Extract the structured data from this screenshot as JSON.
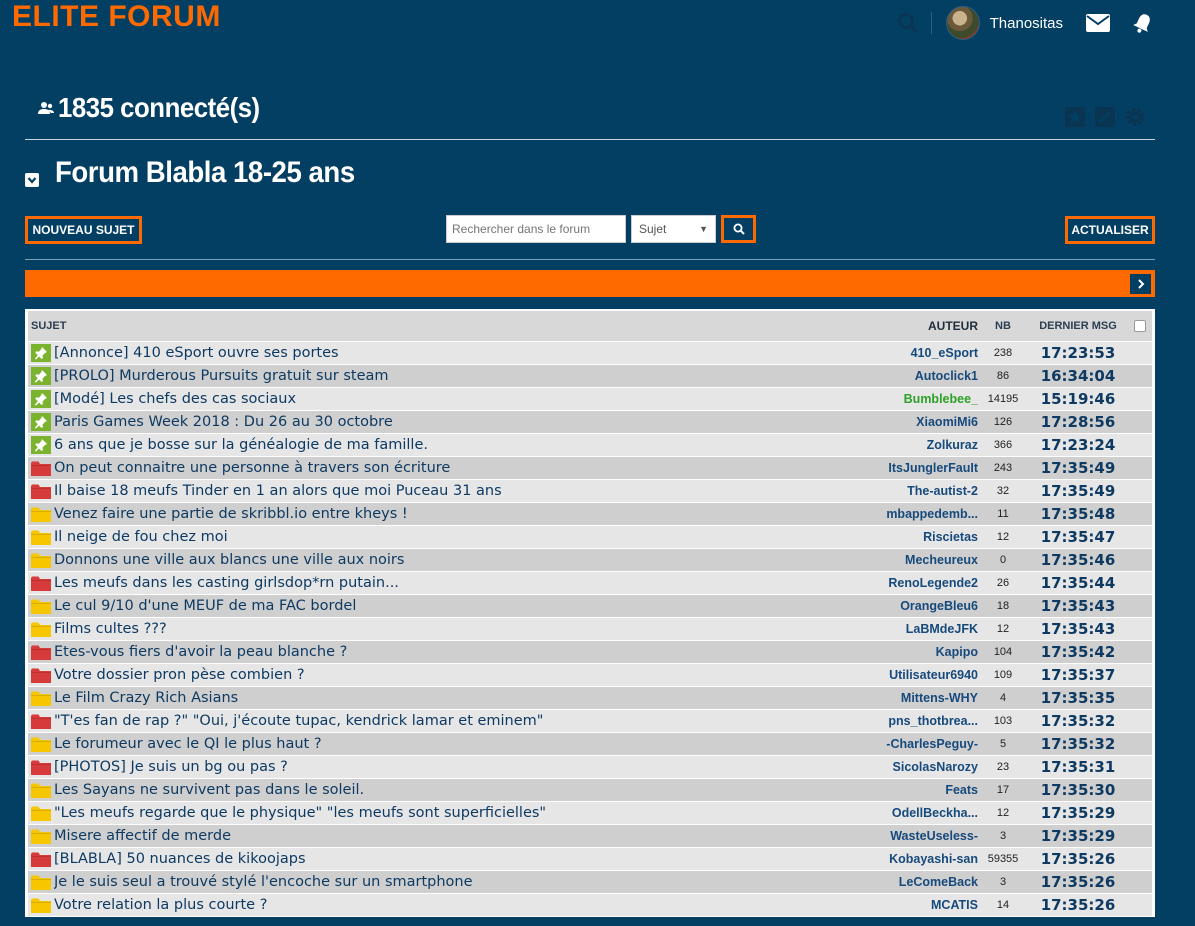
{
  "header": {
    "logo": "ELITE FORUM",
    "username": "Thanositas"
  },
  "online": {
    "count_text": "1835 connecté(s)"
  },
  "forum": {
    "title": "Forum Blabla 18-25 ans"
  },
  "toolbar": {
    "new_topic": "NOUVEAU SUJET",
    "search_placeholder": "Rechercher dans le forum",
    "search_scope": "Sujet",
    "refresh": "ACTUALISER"
  },
  "table": {
    "headers": {
      "subject": "SUJET",
      "author": "AUTEUR",
      "nb": "NB",
      "last": "DERNIER MSG"
    },
    "rows": [
      {
        "icon": "pin",
        "subject": "[Annonce] 410 eSport ouvre ses portes",
        "author": "410_eSport",
        "nb": "238",
        "last": "17:23:53"
      },
      {
        "icon": "pin",
        "subject": "[PROLO] Murderous Pursuits gratuit sur steam",
        "author": "Autoclick1",
        "nb": "86",
        "last": "16:34:04"
      },
      {
        "icon": "pin",
        "subject": "[Modé] Les chefs des cas sociaux",
        "author": "Bumblebee_",
        "nb": "14195",
        "last": "15:19:46",
        "author_color": "green"
      },
      {
        "icon": "pin",
        "subject": "Paris Games Week 2018 : Du 26 au 30 octobre",
        "author": "XiaomiMi6",
        "nb": "126",
        "last": "17:28:56"
      },
      {
        "icon": "pin",
        "subject": "6 ans que je bosse sur la généalogie de ma famille.",
        "author": "Zolkuraz",
        "nb": "366",
        "last": "17:23:24"
      },
      {
        "icon": "folder-red",
        "subject": "On peut connaitre une personne à travers son écriture",
        "author": "ItsJunglerFauIt",
        "nb": "243",
        "last": "17:35:49"
      },
      {
        "icon": "folder-red",
        "subject": "Il baise 18 meufs Tinder en 1 an alors que moi Puceau 31 ans",
        "author": "The-autist-2",
        "nb": "32",
        "last": "17:35:49"
      },
      {
        "icon": "folder-yellow",
        "subject": "Venez faire une partie de skribbl.io entre kheys !",
        "author": "mbappedemb...",
        "nb": "11",
        "last": "17:35:48"
      },
      {
        "icon": "folder-yellow",
        "subject": "Il neige de fou chez moi",
        "author": "Riscietas",
        "nb": "12",
        "last": "17:35:47"
      },
      {
        "icon": "folder-yellow",
        "subject": "Donnons une ville aux blancs une ville aux noirs",
        "author": "Mecheureux",
        "nb": "0",
        "last": "17:35:46"
      },
      {
        "icon": "folder-red",
        "subject": "Les meufs dans les casting girlsdop*rn putain...",
        "author": "RenoLegende2",
        "nb": "26",
        "last": "17:35:44"
      },
      {
        "icon": "folder-yellow",
        "subject": "Le cul 9/10 d'une MEUF de ma FAC bordel",
        "author": "OrangeBleu6",
        "nb": "18",
        "last": "17:35:43"
      },
      {
        "icon": "folder-yellow",
        "subject": "Films cultes ???",
        "author": "LaBMdeJFK",
        "nb": "12",
        "last": "17:35:43"
      },
      {
        "icon": "folder-red",
        "subject": "Etes-vous fiers d'avoir la peau blanche ?",
        "author": "Kapipo",
        "nb": "104",
        "last": "17:35:42"
      },
      {
        "icon": "folder-red",
        "subject": "Votre dossier pron pèse combien ?",
        "author": "Utilisateur6940",
        "nb": "109",
        "last": "17:35:37"
      },
      {
        "icon": "folder-yellow",
        "subject": "Le Film Crazy Rich Asians",
        "author": "Mittens-WHY",
        "nb": "4",
        "last": "17:35:35"
      },
      {
        "icon": "folder-red",
        "subject": "\"T'es fan de rap ?\" \"Oui, j'écoute tupac, kendrick lamar et eminem\"",
        "author": "pns_thotbrea...",
        "nb": "103",
        "last": "17:35:32"
      },
      {
        "icon": "folder-yellow",
        "subject": "Le forumeur avec le QI le plus haut ?",
        "author": "-CharlesPeguy-",
        "nb": "5",
        "last": "17:35:32"
      },
      {
        "icon": "folder-red",
        "subject": "[PHOTOS] Je suis un bg ou pas ?",
        "author": "SicolasNarozy",
        "nb": "23",
        "last": "17:35:31"
      },
      {
        "icon": "folder-yellow",
        "subject": "Les Sayans ne survivent pas dans le soleil.",
        "author": "Feats",
        "nb": "17",
        "last": "17:35:30"
      },
      {
        "icon": "folder-yellow",
        "subject": "\"Les meufs regarde que le physique\" \"les meufs sont superficielles\"",
        "author": "OdellBeckha...",
        "nb": "12",
        "last": "17:35:29"
      },
      {
        "icon": "folder-yellow",
        "subject": "Misere affectif de merde",
        "author": "WasteUseless-",
        "nb": "3",
        "last": "17:35:29"
      },
      {
        "icon": "folder-red",
        "subject": "[BLABLA] 50 nuances de kikoojaps",
        "author": "Kobayashi-san",
        "nb": "59355",
        "last": "17:35:26"
      },
      {
        "icon": "folder-yellow",
        "subject": "Je le suis seul a trouvé stylé l'encoche sur un smartphone",
        "author": "LeComeBack",
        "nb": "3",
        "last": "17:35:26"
      },
      {
        "icon": "folder-yellow",
        "subject": "Votre relation la plus courte ?",
        "author": "MCATIS",
        "nb": "14",
        "last": "17:35:26"
      }
    ]
  },
  "colors": {
    "background": "#033f63",
    "accent": "#ff6a00",
    "pin": "#7bb32e",
    "folder_red": "#d63a3a",
    "folder_yellow": "#f6c700"
  }
}
